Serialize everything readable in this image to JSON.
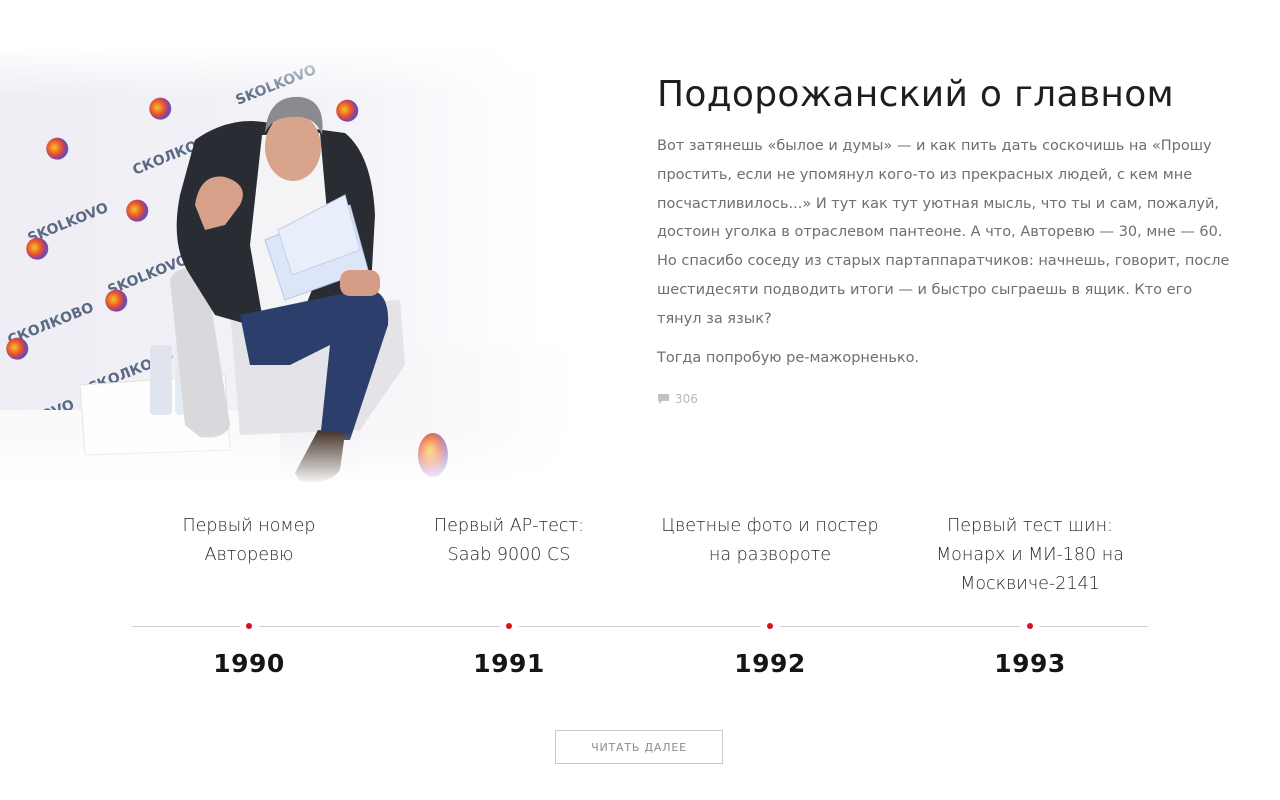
{
  "article": {
    "title": "Подорожанский о главном",
    "paragraph1": "Вот затянешь «былое и думы» — и как пить дать соскочишь на «Прошу простить, если не упомянул кого-то из прекрасных людей, с кем мне посчастливилось...» И тут как тут уютная мысль, что ты и сам, пожалуй, достоин уголка в отраслевом пантеоне. А что, Авторевю — 30, мне — 60. Но спасибо соседу из старых партаппаратчиков: начнешь, говорит, после шестидесяти подводить итоги — и быстро сыграешь в ящик. Кто его тянул за язык?",
    "paragraph2": "Тогда попробую ре-мажорненько.",
    "comments_count": "306",
    "comments_icon": "speech-bubble-icon"
  },
  "photo": {
    "backdrop_text": [
      "СКОЛКОВО",
      "SKOLKOVO"
    ]
  },
  "timeline": {
    "accent_color": "#d2141d",
    "line_color": "#cfcfcf",
    "events": [
      {
        "year": "1990",
        "lines": [
          "Первый номер",
          "Авторевю"
        ]
      },
      {
        "year": "1991",
        "lines": [
          "Первый АР-тест:",
          "Saab 9000 CS"
        ]
      },
      {
        "year": "1992",
        "lines": [
          "Цветные фото и постер",
          "на развороте"
        ]
      },
      {
        "year": "1993",
        "lines": [
          "Первый тест шин:",
          "Монарх и МИ-180 на",
          "Москвиче-2141"
        ]
      }
    ]
  },
  "read_more": {
    "label": "ЧИТАТЬ ДАЛЕЕ"
  }
}
